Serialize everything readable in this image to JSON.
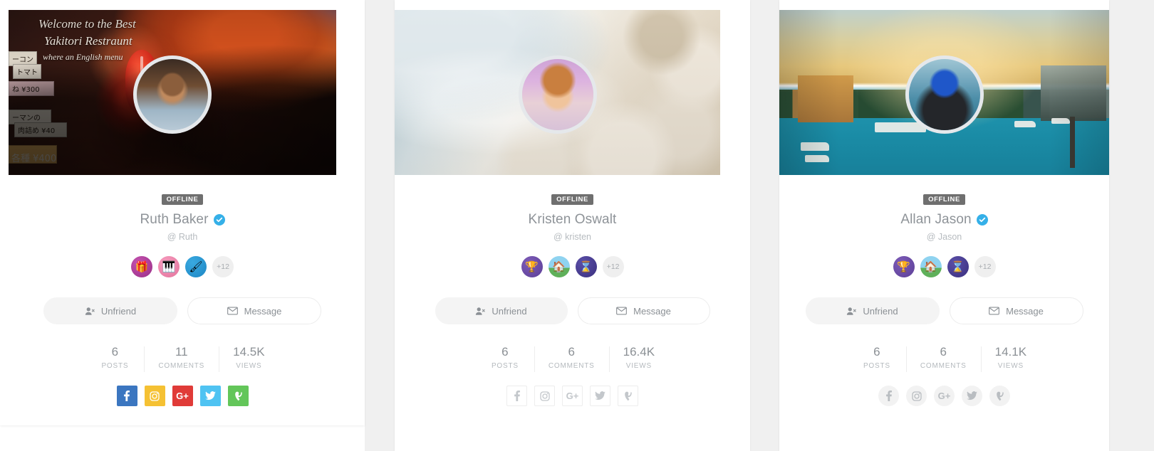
{
  "theme": {
    "page_background": "#ffffff",
    "gutter_background": "#f0f0f0",
    "card_background": "#ffffff",
    "status_badge_background": "#6f6f6f",
    "verified_color": "#35b0e8",
    "name_color": "#8e9398",
    "handle_color": "#b6bbbf",
    "muted_text": "#b4b9bd",
    "divider": "#ededed"
  },
  "social_colors": {
    "facebook": "#3b76c0",
    "instagram": "#f5c133",
    "googleplus": "#e03b38",
    "twitter": "#4fc3f2",
    "vine": "#63c65a"
  },
  "cards": [
    {
      "cover_alt": "Japanese night street with red lantern and autumn leaves",
      "cover_signs": {
        "welcome": "Welcome to the Best",
        "restaurant": "Yakitori Restraunt",
        "menu_note": "where an English menu",
        "chip_a": "ーコン",
        "chip_b": "トマト",
        "chip_c": "ね  ¥300",
        "chip_d": "ーマンの",
        "chip_e": "肉詰め ¥40",
        "chip_f": "",
        "chip_g": "各種 ¥400"
      },
      "avatar_alt": "Smiling child in denim shirt",
      "status": "OFFLINE",
      "name": "Ruth Baker",
      "verified": true,
      "handle": "@ Ruth",
      "badges": [
        {
          "icon": "gift-badge-icon",
          "glyph": "🎁",
          "style": "badge-gift"
        },
        {
          "icon": "piano-badge-icon",
          "glyph": "🎹",
          "style": "badge-piano"
        },
        {
          "icon": "brush-badge-icon",
          "glyph": "🖌",
          "style": "badge-brush"
        }
      ],
      "badge_more": "+12",
      "actions": {
        "unfriend": "Unfriend",
        "message": "Message"
      },
      "stats": [
        {
          "value": "6",
          "label": "POSTS"
        },
        {
          "value": "11",
          "label": "COMMENTS"
        },
        {
          "value": "14.5K",
          "label": "VIEWS"
        }
      ],
      "social_style": "filled",
      "socials": [
        {
          "name": "facebook",
          "label": "f"
        },
        {
          "name": "instagram",
          "label": ""
        },
        {
          "name": "googleplus",
          "label": "G+"
        },
        {
          "name": "twitter",
          "label": ""
        },
        {
          "name": "vine",
          "label": "V"
        }
      ]
    },
    {
      "cover_alt": "Sea foam washing over white beach rocks",
      "avatar_alt": "Boy with straw in his mouth wearing a tie",
      "status": "OFFLINE",
      "name": "Kristen Oswalt",
      "verified": false,
      "handle": "@ kristen",
      "badges": [
        {
          "icon": "trophy-badge-icon",
          "glyph": "🏆",
          "style": "badge-trophy"
        },
        {
          "icon": "house-badge-icon",
          "glyph": "🏠",
          "style": "badge-house"
        },
        {
          "icon": "hourglass-badge-icon",
          "glyph": "⌛",
          "style": "badge-hourglass"
        }
      ],
      "badge_more": "+12",
      "actions": {
        "unfriend": "Unfriend",
        "message": "Message"
      },
      "stats": [
        {
          "value": "6",
          "label": "POSTS"
        },
        {
          "value": "6",
          "label": "COMMENTS"
        },
        {
          "value": "16.4K",
          "label": "VIEWS"
        }
      ],
      "social_style": "outline",
      "socials": [
        {
          "name": "facebook",
          "label": "f"
        },
        {
          "name": "instagram",
          "label": ""
        },
        {
          "name": "googleplus",
          "label": "G+"
        },
        {
          "name": "twitter",
          "label": ""
        },
        {
          "name": "vine",
          "label": "V"
        }
      ]
    },
    {
      "cover_alt": "City waterfront at golden hour with boats",
      "avatar_alt": "Man in blue cap with backpack facing a lake",
      "status": "OFFLINE",
      "name": "Allan Jason",
      "verified": true,
      "handle": "@ Jason",
      "badges": [
        {
          "icon": "trophy-badge-icon",
          "glyph": "🏆",
          "style": "badge-trophy"
        },
        {
          "icon": "house-badge-icon",
          "glyph": "🏠",
          "style": "badge-house"
        },
        {
          "icon": "hourglass-badge-icon",
          "glyph": "⌛",
          "style": "badge-hourglass"
        }
      ],
      "badge_more": "+12",
      "actions": {
        "unfriend": "Unfriend",
        "message": "Message"
      },
      "stats": [
        {
          "value": "6",
          "label": "POSTS"
        },
        {
          "value": "6",
          "label": "COMMENTS"
        },
        {
          "value": "14.1K",
          "label": "VIEWS"
        }
      ],
      "social_style": "circle",
      "socials": [
        {
          "name": "facebook",
          "label": "f"
        },
        {
          "name": "instagram",
          "label": ""
        },
        {
          "name": "googleplus",
          "label": "G+"
        },
        {
          "name": "twitter",
          "label": ""
        },
        {
          "name": "vine",
          "label": "V"
        }
      ]
    }
  ]
}
